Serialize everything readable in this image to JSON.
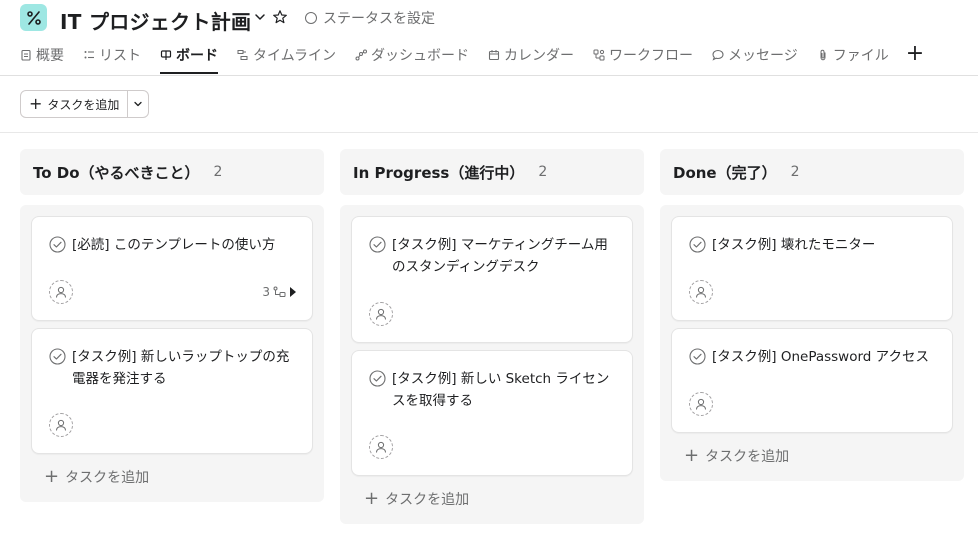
{
  "header": {
    "project_title": "IT プロジェクト計画",
    "status_label": "ステータスを設定"
  },
  "tabs": [
    {
      "label": "概要",
      "icon": "overview-icon"
    },
    {
      "label": "リスト",
      "icon": "list-icon"
    },
    {
      "label": "ボード",
      "icon": "board-icon",
      "active": true
    },
    {
      "label": "タイムライン",
      "icon": "timeline-icon"
    },
    {
      "label": "ダッシュボード",
      "icon": "dashboard-icon"
    },
    {
      "label": "カレンダー",
      "icon": "calendar-icon"
    },
    {
      "label": "ワークフロー",
      "icon": "workflow-icon"
    },
    {
      "label": "メッセージ",
      "icon": "message-icon"
    },
    {
      "label": "ファイル",
      "icon": "file-icon"
    }
  ],
  "toolbar": {
    "add_task_label": "タスクを追加"
  },
  "columns": [
    {
      "title": "To Do（やるべきこと）",
      "count": "2",
      "add_label": "タスクを追加",
      "cards": [
        {
          "title": "[必読] このテンプレートの使い方",
          "subtasks": "3"
        },
        {
          "title": "[タスク例] 新しいラップトップの充電器を発注する"
        }
      ]
    },
    {
      "title": "In Progress（進行中）",
      "count": "2",
      "add_label": "タスクを追加",
      "cards": [
        {
          "title": "[タスク例] マーケティングチーム用のスタンディングデスク"
        },
        {
          "title": "[タスク例] 新しい Sketch ライセンスを取得する"
        }
      ]
    },
    {
      "title": "Done（完了）",
      "count": "2",
      "add_label": "タスクを追加",
      "cards": [
        {
          "title": "[タスク例] 壊れたモニター"
        },
        {
          "title": "[タスク例] OnePassword アクセス"
        }
      ]
    }
  ],
  "colors": {
    "accent_teal": "#9ee7e3",
    "text_primary": "#1e1f21",
    "text_secondary": "#6d6e6f",
    "column_bg": "#f5f5f5"
  }
}
